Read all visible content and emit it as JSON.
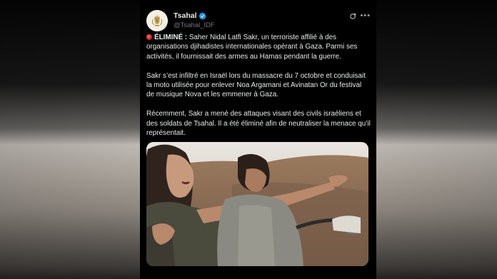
{
  "post": {
    "author_name": "Tsahal",
    "author_handle": "@Tsahal_IDF",
    "verified": true,
    "paragraphs": {
      "p1_lead": "ÉLIMINÉ :",
      "p1_rest": "Saher Nidal Latfi Sakr, un terroriste affilié à des organisations djihadistes internationales opérant à Gaza. Parmi ses activités, il fournissait des armes au Hamas pendant la guerre.",
      "p2": "Sakr s’est infiltré en Israël lors du massacre du 7 octobre et conduisait la moto utilisée pour enlever Noa Argamani et Avinatan Or du festival de musique Nova et les emmener à Gaza.",
      "p3": "Récemment, Sakr a mené des attaques visant des civils israéliens et des soldats de Tsahal. Il a été éliminé afin de neutraliser la menace qu’il représentait."
    },
    "icons": {
      "status": "red-circle-icon",
      "verified": "verified-badge-icon",
      "grok": "grok-icon",
      "more": "more-options-icon"
    }
  },
  "colors": {
    "verified_blue": "#1d9bf0",
    "background": "#000000",
    "text": "#e7e9ea",
    "secondary_text": "#71767b"
  }
}
